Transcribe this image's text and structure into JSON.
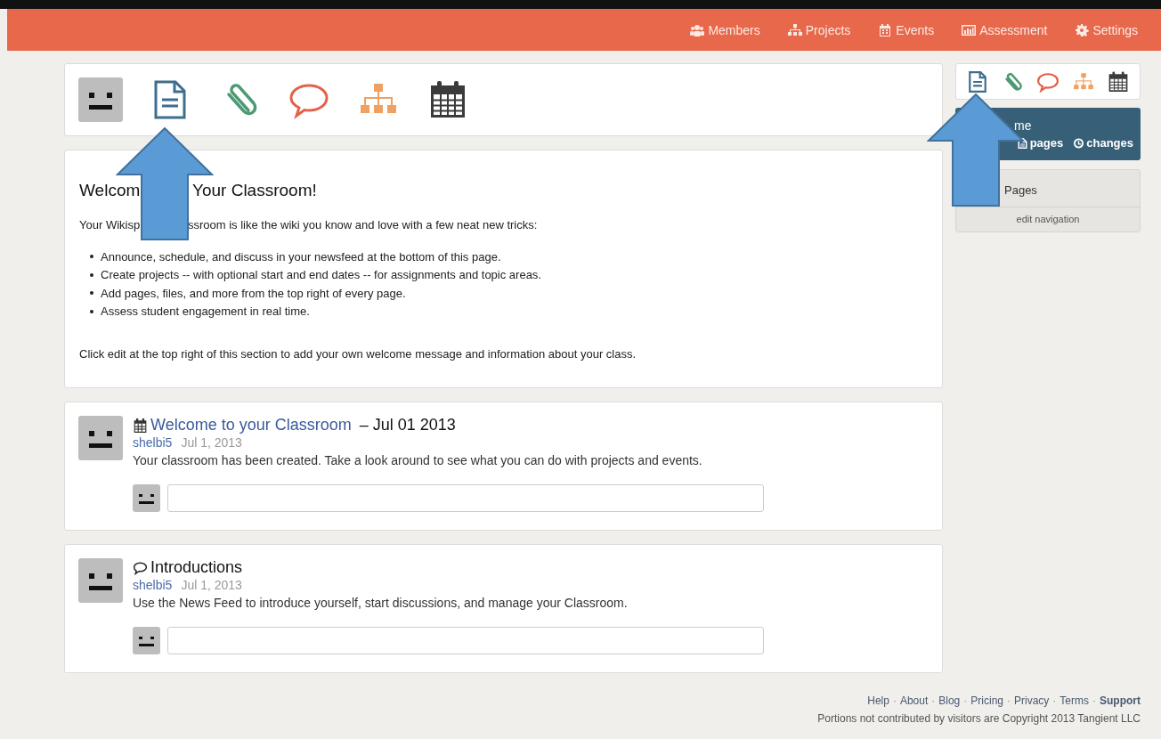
{
  "nav": [
    {
      "kind": "members",
      "label": "Members"
    },
    {
      "kind": "projects",
      "label": "Projects"
    },
    {
      "kind": "events",
      "label": "Events"
    },
    {
      "kind": "assessment",
      "label": "Assessment"
    },
    {
      "kind": "settings",
      "label": "Settings"
    }
  ],
  "welcome": {
    "title_parts": [
      "Welcom",
      "Your Classroom!"
    ],
    "intro_parts": [
      "Your Wikisp",
      "ssroom is like the wiki you know and love with a few neat new tricks:"
    ],
    "bullets": [
      "Announce, schedule, and discuss in your newsfeed at the bottom of this page.",
      "Create projects -- with optional start and end dates -- for assignments and topic areas.",
      "Add pages, files, and more from the top right of every page.",
      "Assess student engagement in real time."
    ],
    "closing": "Click edit at the top right of this section to add your own welcome message and information about your class."
  },
  "posts": [
    {
      "kind": "event",
      "title": "Welcome to your Classroom",
      "suffix": "– Jul 01 2013",
      "author": "shelbi5",
      "date": "Jul 1, 2013",
      "body": "Your classroom has been created. Take a look around to see what you can do with projects and events."
    },
    {
      "kind": "discussion",
      "title": "Introductions",
      "author": "shelbi5",
      "date": "Jul 1, 2013",
      "body": "Use the News Feed to introduce yourself, start discussions, and manage your Classroom."
    }
  ],
  "sidebar": {
    "home_title": "me",
    "links": [
      {
        "kind": "pages",
        "label": "pages"
      },
      {
        "kind": "changes",
        "label": "changes"
      }
    ],
    "pages_title": "Pages",
    "edit_link": "edit navigation"
  },
  "footer": {
    "separator": "·",
    "links": [
      {
        "label": "Help",
        "bold": false
      },
      {
        "label": "About",
        "bold": false
      },
      {
        "label": "Blog",
        "bold": false
      },
      {
        "label": "Pricing",
        "bold": false
      },
      {
        "label": "Privacy",
        "bold": false
      },
      {
        "label": "Terms",
        "bold": false
      },
      {
        "label": "Support",
        "bold": true
      }
    ],
    "copyright": "Portions not contributed by visitors are Copyright 2013 Tangient LLC"
  }
}
